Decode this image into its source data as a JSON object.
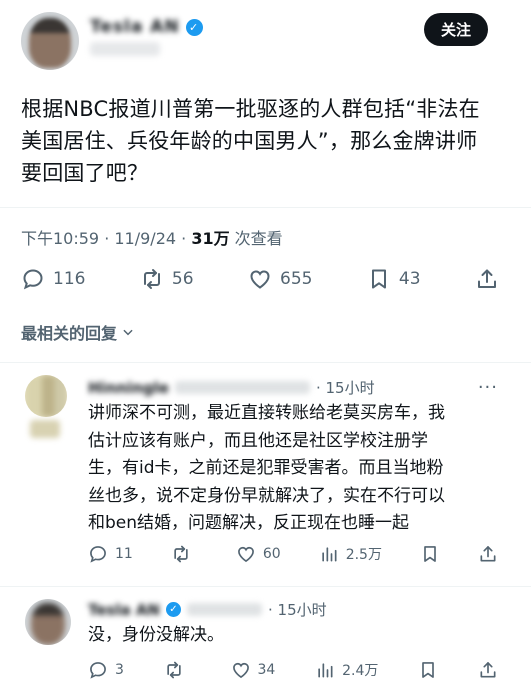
{
  "post": {
    "author_name": "Tesla AN",
    "follow_label": "关注",
    "text_lines": [
      "根据NBC报道川普第一批驱逐的人群包括“非法在",
      "美国居住、兵役年龄的中国男人”，那么金牌讲师",
      "要回国了吧？"
    ],
    "timestamp": "下午10:59 · 11/9/24 · ",
    "views_count": "31万",
    "views_label": " 次查看",
    "stats": {
      "replies": "116",
      "reposts": "56",
      "likes": "655",
      "bookmarks": "43"
    },
    "icons": [
      "reply-icon",
      "repost-icon",
      "like-icon",
      "bookmark-icon",
      "share-icon"
    ]
  },
  "sort_label": "最相关的回复",
  "replies": [
    {
      "name": "Hinningle",
      "handle": "@jlk",
      "time": "15小时",
      "text_lines": [
        "讲师深不可测，最近直接转账给老莫买房车，我",
        "估计应该有账户，而且他还是社区学校注册学",
        "生，有id卡，之前还是犯罪受害者。而且当地粉",
        "丝也多，说不定身份早就解决了，实在不行可以",
        "和ben结婚，问题解决，反正现在也睡一起"
      ],
      "stats": {
        "replies": "11",
        "reposts": "",
        "likes": "60",
        "views": "2.5万"
      }
    },
    {
      "name": "Tesla AN",
      "handle": "@",
      "time": "15小时",
      "text_lines": [
        "没，身份没解决。"
      ],
      "stats": {
        "replies": "3",
        "reposts": "",
        "likes": "34",
        "views": "2.4万"
      }
    }
  ],
  "colors": {
    "text": "#0f1419",
    "muted": "#536471",
    "verified": "#1d9bf0",
    "divider": "#eff3f4"
  }
}
